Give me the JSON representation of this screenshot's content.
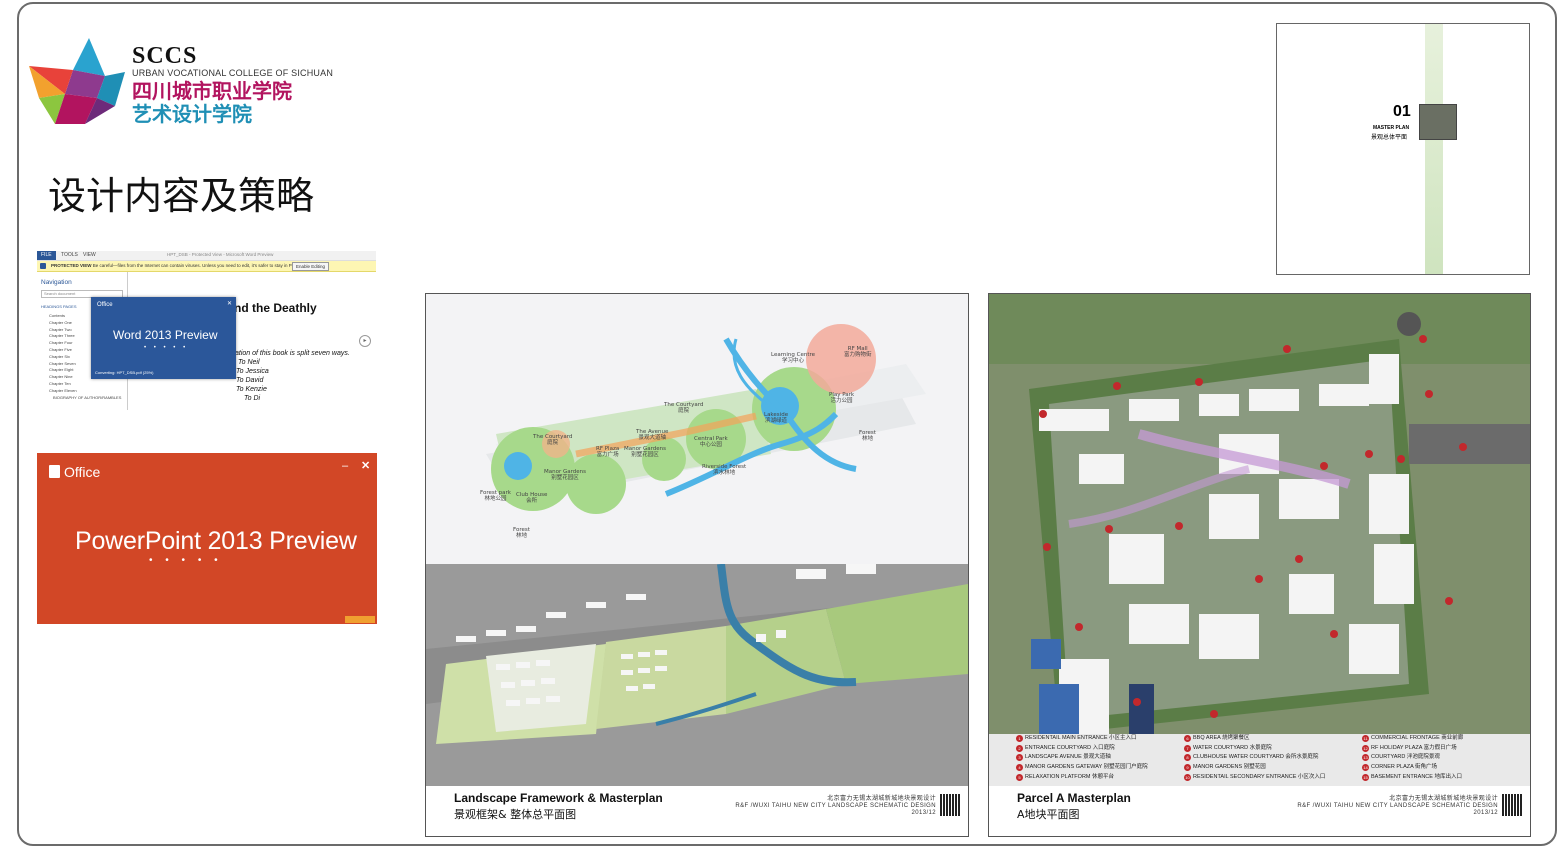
{
  "logo": {
    "abbr": "SCCS",
    "english": "URBAN VOCATIONAL COLLEGE OF SICHUAN",
    "cn_school": "四川城市职业学院",
    "cn_dept": "艺术设计学院",
    "colors": [
      "#e8423a",
      "#f2a12e",
      "#8cc63f",
      "#2aa3cf",
      "#8e3a8e",
      "#b2145f"
    ]
  },
  "slide_title": "设计内容及策略",
  "word_window": {
    "tabs": [
      "FILE",
      "TOOLS",
      "VIEW"
    ],
    "window_title": "HPT_DSB - Protected View - Microsoft Word Preview",
    "protected_label": "PROTECTED VIEW",
    "protected_message": "Be careful—files from the Internet can contain viruses. Unless you need to edit, it's safer to stay in Protected View.",
    "enable_editing": "Enable Editing",
    "nav_title": "Navigation",
    "nav_search_placeholder": "Search document",
    "nav_tabs": "HEADINGS   PAGES",
    "chapters": [
      "Contents",
      "Chapter One",
      "Chapter Two",
      "Chapter Three",
      "Chapter Four",
      "Chapter Five",
      "Chapter Six",
      "Chapter Seven",
      "Chapter Eight",
      "Chapter Nine",
      "Chapter Ten",
      "Chapter Eleven",
      "BIOGRAPHY OF AUTHOR/RAMBLES"
    ],
    "doc_heading": "nd the Deathly",
    "doc_line": "ation of this book is split seven ways.",
    "doc_to": [
      "To Neil",
      "To Jessica",
      "To David",
      "To Kenzie",
      "To Di"
    ],
    "splash_office": "Office",
    "splash_title": "Word 2013 Preview",
    "splash_dots": "• • • • •",
    "splash_converting": "Converting: HPT_DSB.pdf (25%)"
  },
  "ppt_window": {
    "office": "Office",
    "title": "PowerPoint 2013 Preview",
    "dots": "• • • • •",
    "minimize": "–",
    "close": "✕"
  },
  "master_plan_thumb": {
    "number": "01",
    "label_en": "MASTER PLAN",
    "label_cn": "景观总体平面"
  },
  "panel_left": {
    "caption_en": "Landscape Framework & Masterplan",
    "caption_cn": "景观框架& 整体总平面图",
    "right_cn": "北京富力无锡太湖城新城地块景观设计",
    "right_en": "R&F /WUXI TAIHU NEW CITY  LANDSCAPE SCHEMATIC DESIGN",
    "date": "2013/12",
    "map_labels": [
      {
        "en": "Learning Centre",
        "cn": "学习中心"
      },
      {
        "en": "RF Mall",
        "cn": "富力购物街"
      },
      {
        "en": "The Courtyard",
        "cn": "庭院"
      },
      {
        "en": "The Avenue",
        "cn": "景观大道轴"
      },
      {
        "en": "Manor Gardens",
        "cn": "别墅花园区"
      },
      {
        "en": "Lakeside",
        "cn": "滨湖绿道"
      },
      {
        "en": "Play Park",
        "cn": "活力公园"
      },
      {
        "en": "Forest",
        "cn": "林地"
      },
      {
        "en": "The Courtyard",
        "cn": "庭院"
      },
      {
        "en": "RF Plaza",
        "cn": "富力广场"
      },
      {
        "en": "Manor Gardens",
        "cn": "别墅花园区"
      },
      {
        "en": "Central Park",
        "cn": "中心公园"
      },
      {
        "en": "Riverside Forest",
        "cn": "滨水林地"
      },
      {
        "en": "Forest park",
        "cn": "林地公园"
      },
      {
        "en": "Club House",
        "cn": "会所"
      },
      {
        "en": "Forest",
        "cn": "林地"
      }
    ]
  },
  "panel_right": {
    "caption_en": "Parcel A Masterplan",
    "caption_cn": "A地块平面图",
    "right_cn": "北京富力无锡太湖城新城地块景观设计",
    "right_en": "R&F /WUXI TAIHU NEW CITY  LANDSCAPE SCHEMATIC DESIGN",
    "date": "2013/12",
    "legend": [
      {
        "n": "1",
        "text": "RESIDENTAIL MAIN ENTRANCE 小区主入口"
      },
      {
        "n": "2",
        "text": "ENTRANCE COURTYARD 入口庭院"
      },
      {
        "n": "3",
        "text": "LANDSCAPE AVENUE 景观大道轴"
      },
      {
        "n": "4",
        "text": "MANOR GARDENS GATEWAY 别墅花园门户庭院"
      },
      {
        "n": "5",
        "text": "RELAXATION PLATFORM 休憩平台"
      },
      {
        "n": "6",
        "text": "BBQ AREA 烧烤聚餐区"
      },
      {
        "n": "7",
        "text": "WATER COURTYARD 水景庭院"
      },
      {
        "n": "8",
        "text": "CLUBHOUSE WATER COURTYARD 会所水景庭院"
      },
      {
        "n": "9",
        "text": "MANOR GARDENS 别墅花园"
      },
      {
        "n": "10",
        "text": "RESIDENTAIL SECONDARY ENTRANCE 小区次入口"
      },
      {
        "n": "11",
        "text": "COMMERCIAL FRONTAGE 商业前廊"
      },
      {
        "n": "12",
        "text": "RF HOLIDAY PLAZA 富力假日广场"
      },
      {
        "n": "13",
        "text": "COURTYARD 泮池庭院景观"
      },
      {
        "n": "14",
        "text": "CORNER PLAZA 街角广场"
      },
      {
        "n": "15",
        "text": "BASEMENT ENTRANCE 地库出入口"
      }
    ]
  }
}
